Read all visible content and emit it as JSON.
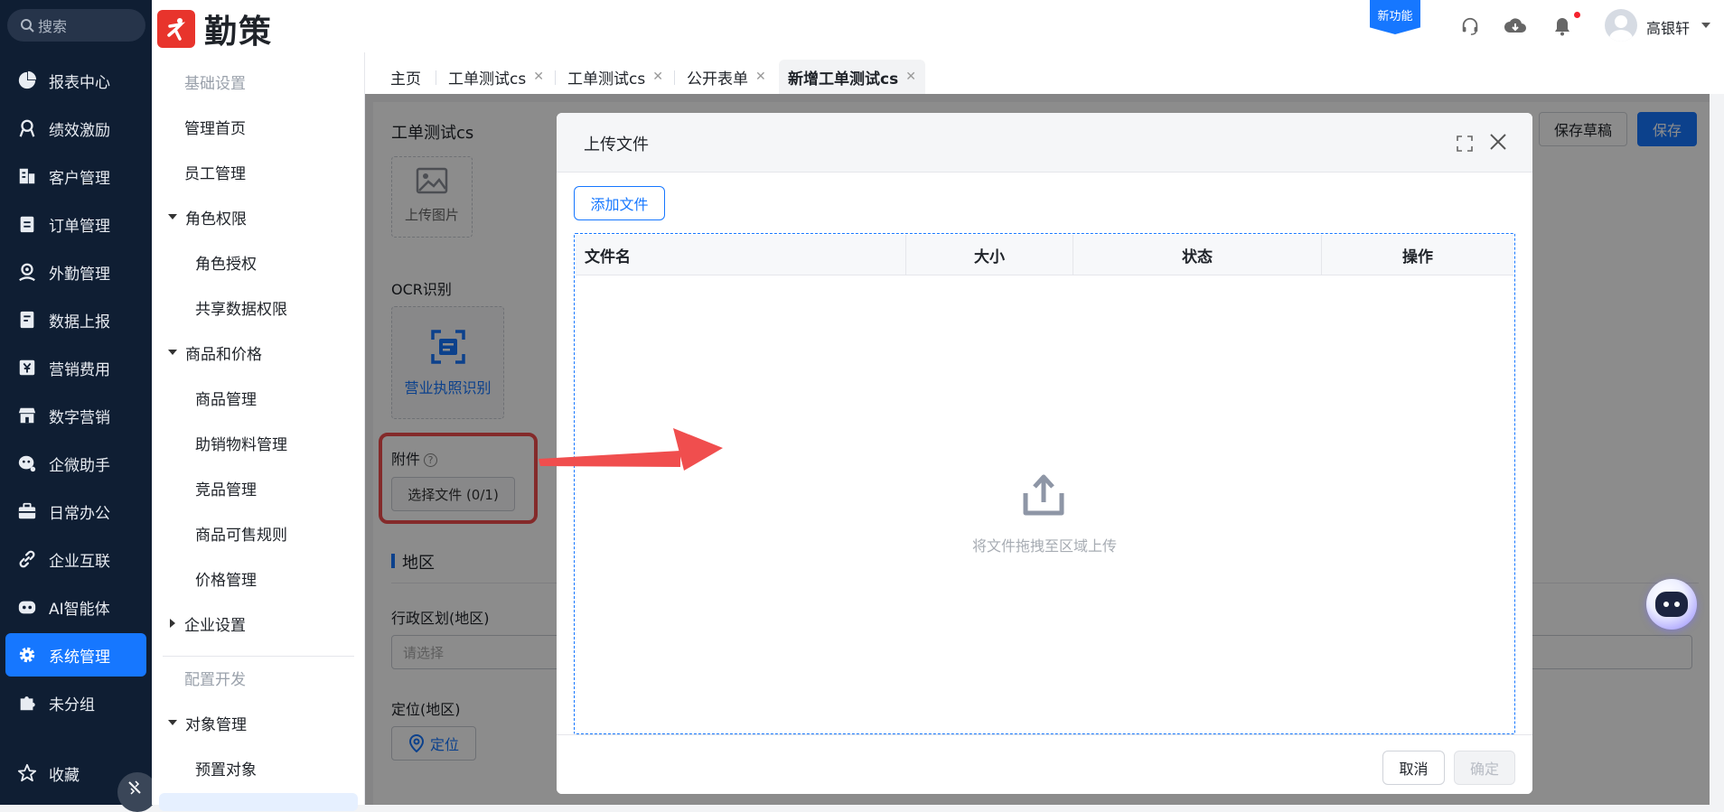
{
  "sidebar": {
    "search_placeholder": "搜索",
    "items": [
      {
        "label": "报表中心",
        "icon": "pie-chart-icon"
      },
      {
        "label": "绩效激励",
        "icon": "medal-icon"
      },
      {
        "label": "客户管理",
        "icon": "building-icon"
      },
      {
        "label": "订单管理",
        "icon": "clipboard-icon"
      },
      {
        "label": "外勤管理",
        "icon": "location-person-icon"
      },
      {
        "label": "数据上报",
        "icon": "report-icon"
      },
      {
        "label": "营销费用",
        "icon": "yen-icon"
      },
      {
        "label": "数字营销",
        "icon": "store-icon"
      },
      {
        "label": "企微助手",
        "icon": "wecom-icon"
      },
      {
        "label": "日常办公",
        "icon": "briefcase-icon"
      },
      {
        "label": "企业互联",
        "icon": "link-icon"
      },
      {
        "label": "AI智能体",
        "icon": "bot-icon"
      },
      {
        "label": "系统管理",
        "icon": "gear-icon"
      },
      {
        "label": "未分组",
        "icon": "puzzle-icon"
      }
    ],
    "active_index": 12,
    "favorites_label": "收藏"
  },
  "topbar": {
    "logo_text": "勤策",
    "new_feature_badge": "新功能",
    "username": "高银轩"
  },
  "submenu": {
    "group_basic": "基础设置",
    "admin_home": "管理首页",
    "employee_mgmt": "员工管理",
    "role_perm": "角色权限",
    "role_auth": "角色授权",
    "shared_data_perm": "共享数据权限",
    "goods_price": "商品和价格",
    "goods_mgmt": "商品管理",
    "promo_material_mgmt": "助销物料管理",
    "competitor_mgmt": "竞品管理",
    "goods_sale_rules": "商品可售规则",
    "price_mgmt": "价格管理",
    "enterprise_settings": "企业设置",
    "group_config_dev": "配置开发",
    "object_mgmt": "对象管理",
    "preset_objects": "预置对象"
  },
  "tabs": [
    {
      "label": "主页",
      "closable": false,
      "active": false
    },
    {
      "label": "工单测试cs",
      "closable": true,
      "active": false
    },
    {
      "label": "工单测试cs",
      "closable": true,
      "active": false
    },
    {
      "label": "公开表单",
      "closable": true,
      "active": false
    },
    {
      "label": "新增工单测试cs",
      "closable": true,
      "active": true
    }
  ],
  "form": {
    "title": "工单测试cs",
    "save_draft_label": "保存草稿",
    "save_label": "保存",
    "upload_image_label": "上传图片",
    "ocr_label": "OCR识别",
    "ocr_button_label": "营业执照识别",
    "attachment_label": "附件",
    "help_glyph": "?",
    "choose_file_label": "选择文件 (0/1)",
    "region_section": "地区",
    "admin_region_label": "行政区划(地区)",
    "admin_region_placeholder": "请选择",
    "location_label": "定位(地区)",
    "locate_button_label": "定位"
  },
  "modal": {
    "title": "上传文件",
    "add_file_label": "添加文件",
    "columns": [
      "文件名",
      "大小",
      "状态",
      "操作"
    ],
    "drop_hint": "将文件拖拽至区域上传",
    "cancel_label": "取消",
    "confirm_label": "确定"
  },
  "colors": {
    "primary": "#1677ff",
    "sidebar_bg": "#0f1e33",
    "annotation_red": "#f04e4e"
  }
}
